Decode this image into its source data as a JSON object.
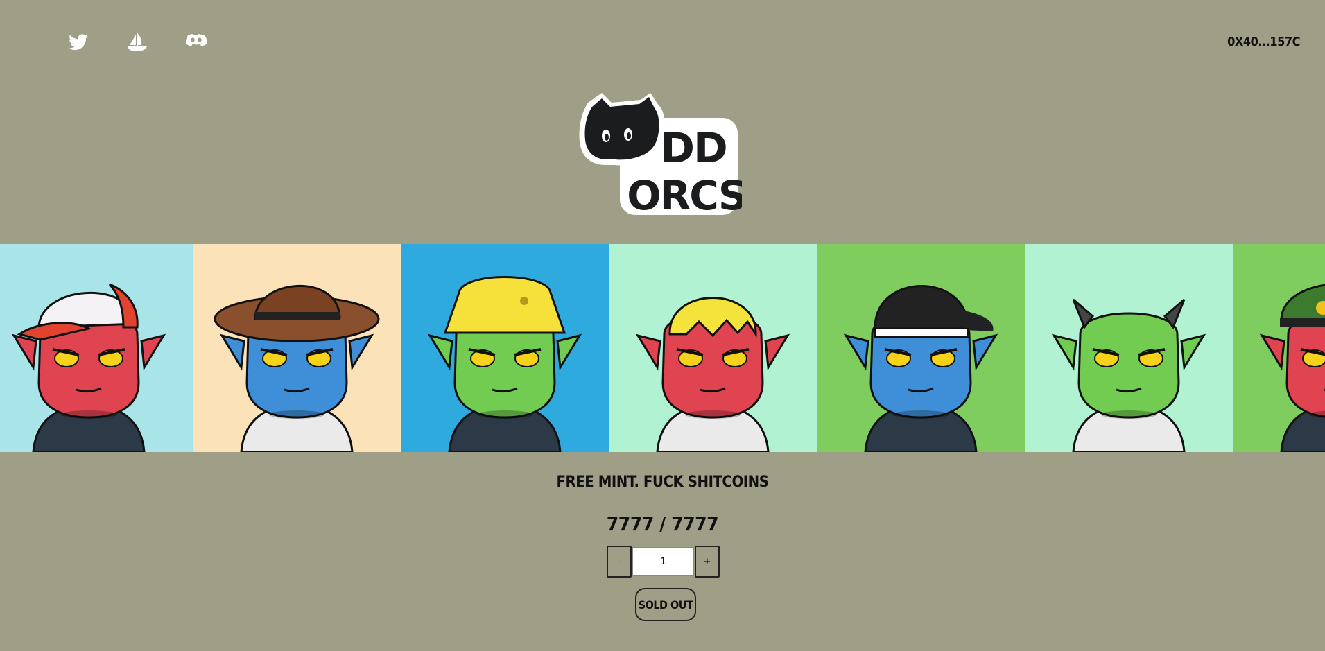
{
  "header": {
    "social_links": [
      {
        "name": "twitter-icon"
      },
      {
        "name": "opensea-icon"
      },
      {
        "name": "discord-icon"
      }
    ],
    "wallet_address": "0X40...157C"
  },
  "logo": {
    "text_line1": "DD",
    "text_line2": "ORCS"
  },
  "gallery": {
    "tiles": [
      {
        "skin": "#e04450",
        "bg": "#a9e5e8",
        "hat": "cap"
      },
      {
        "skin": "#3f8fd8",
        "bg": "#fbe2b8",
        "hat": "cowboy"
      },
      {
        "skin": "#72cc52",
        "bg": "#2eaadf",
        "hat": "bucket"
      },
      {
        "skin": "#e04450",
        "bg": "#b1f2d2",
        "hat": "slime"
      },
      {
        "skin": "#3f8fd8",
        "bg": "#7fcc5f",
        "hat": "backcap"
      },
      {
        "skin": "#72cc52",
        "bg": "#b1f2d2",
        "hat": "horns"
      },
      {
        "skin": "#e04450",
        "bg": "#7fcc5f",
        "hat": "military"
      }
    ]
  },
  "mint": {
    "tagline": "FREE MINT. FUCK SHITCOINS",
    "counter": "7777 / 7777",
    "decrement_label": "-",
    "increment_label": "+",
    "quantity_value": "1",
    "sold_out_label": "SOLD OUT"
  },
  "colors": {
    "background": "#9f9e87",
    "ink": "#111111"
  }
}
